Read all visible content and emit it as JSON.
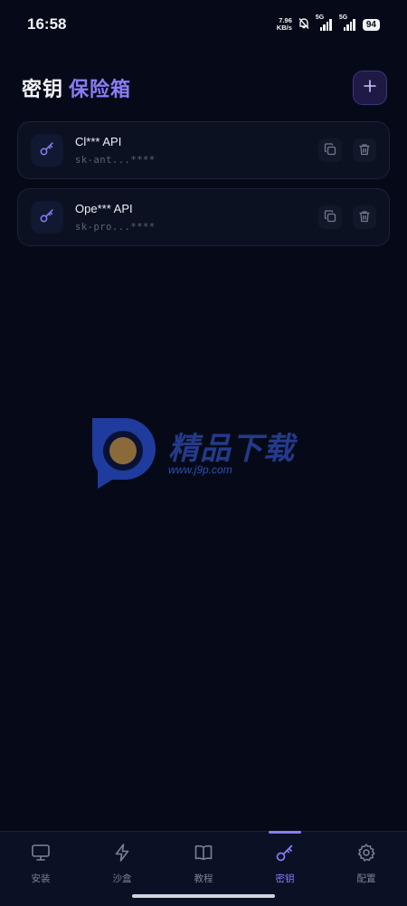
{
  "status": {
    "time": "16:58",
    "net_speed_value": "7.96",
    "net_speed_unit": "KB/s",
    "signal1_label": "5G",
    "signal2_label": "5G",
    "battery": "94"
  },
  "header": {
    "title_part1": "密钥",
    "title_part2": "保险箱"
  },
  "keys": [
    {
      "name": "Cl*** API",
      "masked": "sk-ant...****"
    },
    {
      "name": "Ope*** API",
      "masked": "sk-pro...****"
    }
  ],
  "watermark": {
    "text": "精品下载",
    "url": "www.j9p.com"
  },
  "nav": {
    "items": [
      {
        "label": "安装",
        "icon": "monitor-icon"
      },
      {
        "label": "沙盒",
        "icon": "lightning-icon"
      },
      {
        "label": "教程",
        "icon": "book-icon"
      },
      {
        "label": "密钥",
        "icon": "key-icon"
      },
      {
        "label": "配置",
        "icon": "gear-icon"
      }
    ],
    "active_label": "密钥"
  },
  "colors": {
    "background": "#060a18",
    "accent": "#8b7cf6",
    "card": "#0c1122",
    "nav_inactive": "#7c8296"
  }
}
